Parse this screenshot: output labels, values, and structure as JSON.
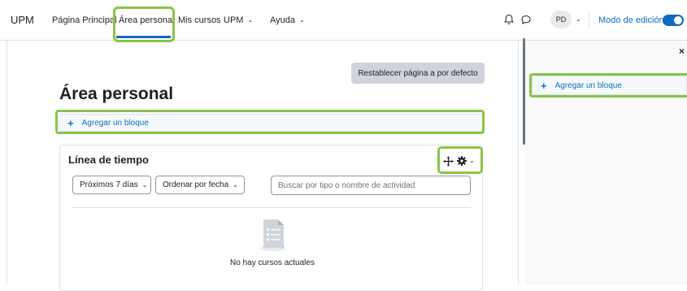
{
  "brand": "UPM",
  "nav": {
    "home": "Página Principal",
    "dashboard": "Área personal",
    "my_courses": "Mis cursos",
    "upm": "UPM",
    "help": "Ayuda"
  },
  "user": {
    "initials": "PD"
  },
  "edit_mode": {
    "label": "Modo de edición",
    "enabled": true
  },
  "main": {
    "reset_button": "Restablecer página a por defecto",
    "title": "Área personal",
    "add_block": "Agregar un bloque"
  },
  "timeline": {
    "title": "Línea de tiempo",
    "filter_days": "Próximos 7 días",
    "sort": "Ordenar por fecha",
    "search_placeholder": "Buscar por tipo o nombre de actividad",
    "empty_text": "No hay cursos actuales"
  },
  "drawer": {
    "add_block": "Agregar un bloque",
    "close": "×"
  },
  "icons": {
    "notifications": "bell-icon",
    "messages": "chat-icon",
    "move": "move-icon",
    "settings": "cog-icon"
  },
  "colors": {
    "primary": "#0f6cbf",
    "highlight": "#8bc34a"
  }
}
